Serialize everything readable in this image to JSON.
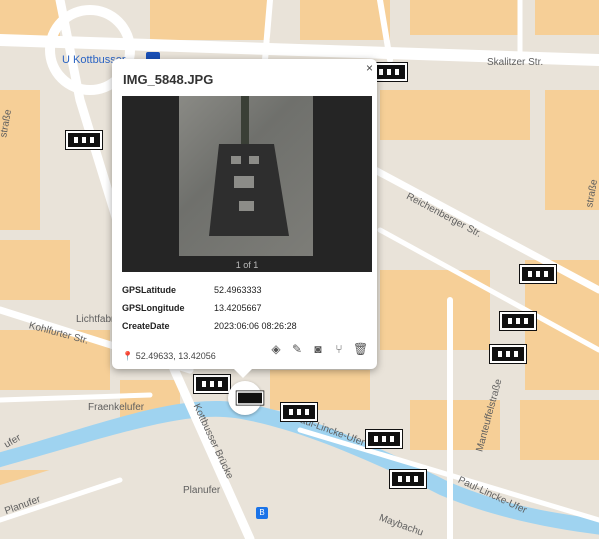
{
  "map": {
    "labels": {
      "u_station": "U Kottbusser",
      "skalitzer": "Skalitzer Str.",
      "reichenberger": "Reichenberger Str.",
      "kohlfurter": "Kohlfurter Str.",
      "lichtfabri": "Lichtfabri",
      "fraenkelufer": "Fraenkelufer",
      "kottbusser_bruecke": "Kottbusser Brücke",
      "paul_lincke_1": "Paul-Lincke-Ufer",
      "paul_lincke_2": "Paul-Lincke-Ufer",
      "planufer": "Planufer",
      "planufer2": "Planufer",
      "ufer": "ufer",
      "manteuffel": "Manteuffelstraße",
      "maybach": "Maybachu",
      "str_left": "straße",
      "str_right": "straße"
    },
    "colors": {
      "water": "#9fd3f0",
      "building": "#f6cf97",
      "road": "#ffffff",
      "ground": "#e9e3d9"
    }
  },
  "popup": {
    "title": "IMG_5848.JPG",
    "close_label": "×",
    "photo_counter": "1 of 1",
    "fields": [
      {
        "key": "GPSLatitude",
        "value": "52.4963333"
      },
      {
        "key": "GPSLongitude",
        "value": "13.4205667"
      },
      {
        "key": "CreateDate",
        "value": "2023:06:06 08:26:28"
      }
    ],
    "coords": "52.49633, 13.42056",
    "tools": [
      "paint-bucket-icon",
      "pencil-icon",
      "camera-icon",
      "route-icon",
      "trash-icon"
    ]
  },
  "bus_label": "B"
}
